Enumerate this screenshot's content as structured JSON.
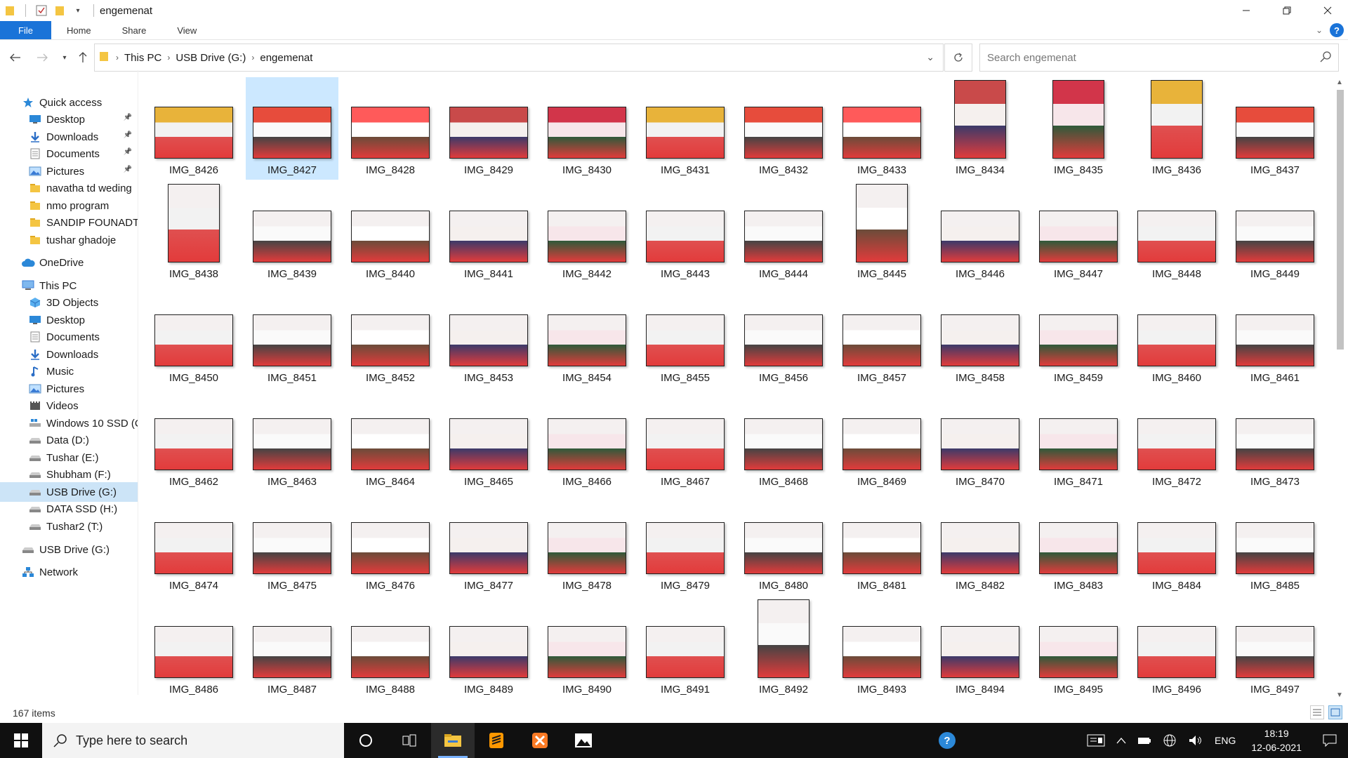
{
  "window": {
    "title": "engemenat"
  },
  "ribbon": {
    "tabs": [
      "File",
      "Home",
      "Share",
      "View"
    ]
  },
  "address": {
    "crumbs": [
      "This PC",
      "USB Drive (G:)",
      "engemenat"
    ],
    "search_placeholder": "Search engemenat"
  },
  "sidebar": {
    "items": [
      {
        "label": "Quick access",
        "icon": "star-icon",
        "level": 0
      },
      {
        "label": "Desktop",
        "icon": "desktop-icon",
        "level": 1,
        "pinned": true
      },
      {
        "label": "Downloads",
        "icon": "download-icon",
        "level": 1,
        "pinned": true
      },
      {
        "label": "Documents",
        "icon": "document-icon",
        "level": 1,
        "pinned": true
      },
      {
        "label": "Pictures",
        "icon": "pictures-icon",
        "level": 1,
        "pinned": true
      },
      {
        "label": "navatha td weding",
        "icon": "folder-icon",
        "level": 1
      },
      {
        "label": "nmo program",
        "icon": "folder-icon",
        "level": 1
      },
      {
        "label": "SANDIP FOUNADTI(",
        "icon": "folder-icon",
        "level": 1
      },
      {
        "label": "tushar ghadoje",
        "icon": "folder-icon",
        "level": 1
      },
      {
        "label": "OneDrive",
        "icon": "cloud-icon",
        "level": 0
      },
      {
        "label": "This PC",
        "icon": "pc-icon",
        "level": 0
      },
      {
        "label": "3D Objects",
        "icon": "cube-icon",
        "level": 1
      },
      {
        "label": "Desktop",
        "icon": "desktop-icon",
        "level": 1
      },
      {
        "label": "Documents",
        "icon": "document-icon",
        "level": 1
      },
      {
        "label": "Downloads",
        "icon": "download-icon",
        "level": 1
      },
      {
        "label": "Music",
        "icon": "music-icon",
        "level": 1
      },
      {
        "label": "Pictures",
        "icon": "pictures-icon",
        "level": 1
      },
      {
        "label": "Videos",
        "icon": "video-icon",
        "level": 1
      },
      {
        "label": "Windows 10 SSD (C",
        "icon": "windows-drive-icon",
        "level": 1
      },
      {
        "label": "Data (D:)",
        "icon": "drive-icon",
        "level": 1
      },
      {
        "label": "Tushar (E:)",
        "icon": "drive-icon",
        "level": 1
      },
      {
        "label": "Shubham (F:)",
        "icon": "drive-icon",
        "level": 1
      },
      {
        "label": "USB Drive (G:)",
        "icon": "drive-icon",
        "level": 1,
        "selected": true
      },
      {
        "label": "DATA SSD (H:)",
        "icon": "drive-icon",
        "level": 1
      },
      {
        "label": "Tushar2 (T:)",
        "icon": "drive-icon",
        "level": 1
      },
      {
        "label": "USB Drive (G:)",
        "icon": "drive-icon",
        "level": 0
      },
      {
        "label": "Network",
        "icon": "network-icon",
        "level": 0
      }
    ]
  },
  "files": {
    "selected": "IMG_8427",
    "portrait": [
      "IMG_8434",
      "IMG_8435",
      "IMG_8436",
      "IMG_8438",
      "IMG_8445",
      "IMG_8492"
    ],
    "names": [
      "IMG_8426",
      "IMG_8427",
      "IMG_8428",
      "IMG_8429",
      "IMG_8430",
      "IMG_8431",
      "IMG_8432",
      "IMG_8433",
      "IMG_8434",
      "IMG_8435",
      "IMG_8436",
      "IMG_8437",
      "IMG_8438",
      "IMG_8439",
      "IMG_8440",
      "IMG_8441",
      "IMG_8442",
      "IMG_8443",
      "IMG_8444",
      "IMG_8445",
      "IMG_8446",
      "IMG_8447",
      "IMG_8448",
      "IMG_8449",
      "IMG_8450",
      "IMG_8451",
      "IMG_8452",
      "IMG_8453",
      "IMG_8454",
      "IMG_8455",
      "IMG_8456",
      "IMG_8457",
      "IMG_8458",
      "IMG_8459",
      "IMG_8460",
      "IMG_8461",
      "IMG_8462",
      "IMG_8463",
      "IMG_8464",
      "IMG_8465",
      "IMG_8466",
      "IMG_8467",
      "IMG_8468",
      "IMG_8469",
      "IMG_8470",
      "IMG_8471",
      "IMG_8472",
      "IMG_8473",
      "IMG_8474",
      "IMG_8475",
      "IMG_8476",
      "IMG_8477",
      "IMG_8478",
      "IMG_8479",
      "IMG_8480",
      "IMG_8481",
      "IMG_8482",
      "IMG_8483",
      "IMG_8484",
      "IMG_8485",
      "IMG_8486",
      "IMG_8487",
      "IMG_8488",
      "IMG_8489",
      "IMG_8490",
      "IMG_8491",
      "IMG_8492",
      "IMG_8493",
      "IMG_8494",
      "IMG_8495",
      "IMG_8496",
      "IMG_8497"
    ]
  },
  "status": {
    "item_count": "167 items"
  },
  "taskbar": {
    "search_placeholder": "Type here to search",
    "language": "ENG",
    "time": "18:19",
    "date": "12-06-2021"
  },
  "colors": {
    "accent": "#1a73d8",
    "selection": "#cce8ff",
    "taskbar": "#101010"
  }
}
